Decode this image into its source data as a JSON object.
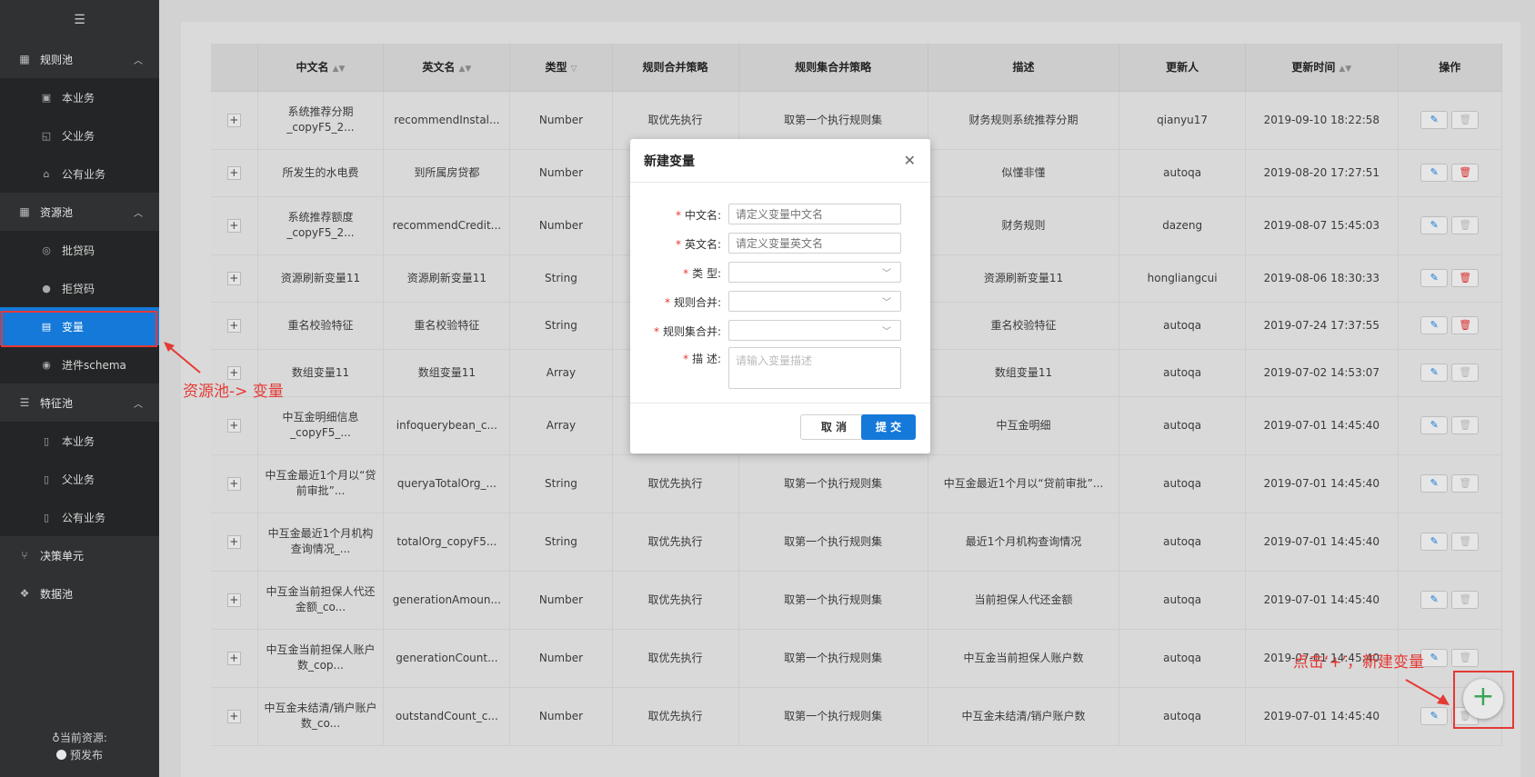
{
  "sidebar": {
    "groups": [
      {
        "label": "规则池",
        "items": [
          "本业务",
          "父业务",
          "公有业务"
        ]
      },
      {
        "label": "资源池",
        "items": [
          "批贷码",
          "拒贷码",
          "变量",
          "进件schema"
        ]
      },
      {
        "label": "特征池",
        "items": [
          "本业务",
          "父业务",
          "公有业务"
        ]
      },
      {
        "label": "决策单元",
        "items": []
      },
      {
        "label": "数据池",
        "items": []
      }
    ],
    "active_item": "变量",
    "current_resource_label": "当前资源:",
    "current_resource_value": "预发布"
  },
  "table": {
    "headers": [
      "中文名",
      "英文名",
      "类型",
      "规则合并策略",
      "规则集合并策略",
      "描述",
      "更新人",
      "更新时间",
      "操作"
    ],
    "rows": [
      [
        "系统推荐分期_copyF5_2...",
        "recommendInstal...",
        "Number",
        "取优先执行",
        "取第一个执行规则集",
        "财务规则系统推荐分期",
        "qianyu17",
        "2019-09-10 18:22:58"
      ],
      [
        "所发生的水电费",
        "到所属房贷都",
        "Number",
        "",
        "",
        "似懂非懂",
        "autoqa",
        "2019-08-20 17:27:51"
      ],
      [
        "系统推荐额度_copyF5_2...",
        "recommendCredit...",
        "Number",
        "",
        "",
        "财务规则",
        "dazeng",
        "2019-08-07 15:45:03"
      ],
      [
        "资源刷新变量11",
        "资源刷新变量11",
        "String",
        "",
        "",
        "资源刷新变量11",
        "hongliangcui",
        "2019-08-06 18:30:33"
      ],
      [
        "重名校验特征",
        "重名校验特征",
        "String",
        "",
        "",
        "重名校验特征",
        "autoqa",
        "2019-07-24 17:37:55"
      ],
      [
        "数组变量11",
        "数组变量11",
        "Array",
        "",
        "",
        "数组变量11",
        "autoqa",
        "2019-07-02 14:53:07"
      ],
      [
        "中互金明细信息_copyF5_...",
        "infoquerybean_c...",
        "Array",
        "",
        "",
        "中互金明细",
        "autoqa",
        "2019-07-01 14:45:40"
      ],
      [
        "中互金最近1个月以“贷前审批”...",
        "queryaTotalOrg_...",
        "String",
        "取优先执行",
        "取第一个执行规则集",
        "中互金最近1个月以“贷前审批”...",
        "autoqa",
        "2019-07-01 14:45:40"
      ],
      [
        "中互金最近1个月机构查询情况_...",
        "totalOrg_copyF5...",
        "String",
        "取优先执行",
        "取第一个执行规则集",
        "最近1个月机构查询情况",
        "autoqa",
        "2019-07-01 14:45:40"
      ],
      [
        "中互金当前担保人代还金额_co...",
        "generationAmoun...",
        "Number",
        "取优先执行",
        "取第一个执行规则集",
        "当前担保人代还金额",
        "autoqa",
        "2019-07-01 14:45:40"
      ],
      [
        "中互金当前担保人账户数_cop...",
        "generationCount...",
        "Number",
        "取优先执行",
        "取第一个执行规则集",
        "中互金当前担保人账户数",
        "autoqa",
        "2019-07-01 14:45:40"
      ],
      [
        "中互金未结清/销户账户数_co...",
        "outstandCount_c...",
        "Number",
        "取优先执行",
        "取第一个执行规则集",
        "中互金未结清/销户账户数",
        "autoqa",
        "2019-07-01 14:45:40"
      ]
    ],
    "delete_enabled_rows": [
      1,
      3,
      4
    ]
  },
  "modal": {
    "title": "新建变量",
    "fields": {
      "cn_name": {
        "label": "中文名:",
        "placeholder": "请定义变量中文名"
      },
      "en_name": {
        "label": "英文名:",
        "placeholder": "请定义变量英文名"
      },
      "type": {
        "label": "类 型:"
      },
      "rule_merge": {
        "label": "规则合并:"
      },
      "ruleset_merge": {
        "label": "规则集合并:"
      },
      "desc": {
        "label": "描 述:",
        "placeholder": "请输入变量描述"
      }
    },
    "cancel_label": "取 消",
    "submit_label": "提 交"
  },
  "annotations": {
    "sidebar_note": "资源池-> 变量",
    "fab_note": "点击‘+’，新建变量"
  },
  "fab_label": "+",
  "colors": {
    "primary": "#1479d9",
    "annotation": "#e53935",
    "fab_plus": "#3aa655"
  }
}
